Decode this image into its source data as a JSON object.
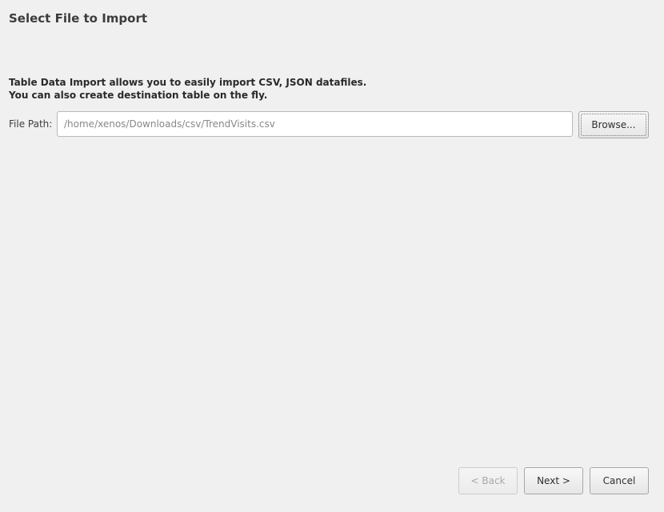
{
  "header": {
    "title": "Select File to Import"
  },
  "description": {
    "line1": "Table Data Import allows you to easily import CSV, JSON datafiles.",
    "line2": "You can also create destination table on the fly."
  },
  "file_path": {
    "label": "File Path:",
    "value": "/home/xenos/Downloads/csv/TrendVisits.csv",
    "browse_label": "Browse..."
  },
  "footer": {
    "back_label": "< Back",
    "back_enabled": false,
    "next_label": "Next >",
    "cancel_label": "Cancel"
  }
}
